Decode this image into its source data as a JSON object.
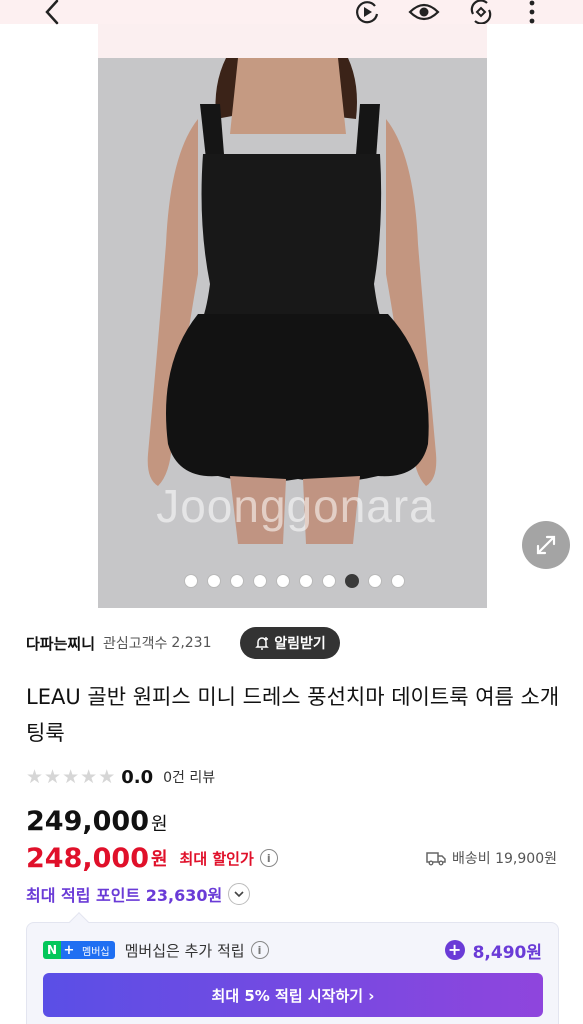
{
  "topbar": {
    "icons": [
      "back-arrow-icon",
      "video-play-icon",
      "eye-icon",
      "rotate-icon",
      "more-vertical-icon"
    ],
    "background": "#fdf0f1"
  },
  "gallery": {
    "watermark": "Joonggonara",
    "total_images": 10,
    "active_index": 8
  },
  "seller": {
    "name": "다파는찌니",
    "follow_label": "관심고객수",
    "follow_count": "2,231",
    "alarm_label": "알림받기"
  },
  "product": {
    "title": "LEAU 골반 원피스 미니 드레스 풍선치마 데이트룩 여름 소개팅룩",
    "rating_score": "0.0",
    "review_label": "0건 리뷰",
    "stars_filled": 0
  },
  "price": {
    "original": "249,000",
    "original_unit": "원",
    "sale": "248,000",
    "sale_unit": "원",
    "sale_label": "최대 할인가",
    "shipping": "배송비 19,900원",
    "points": "최대 적립 포인트 23,630원"
  },
  "membership": {
    "badge_n": "N",
    "badge_plus": "+",
    "badge_label": "멤버십",
    "text": "멤버십은 추가 적립",
    "bonus": "8,490원",
    "cta": "최대 5% 적립 시작하기 ›"
  },
  "colors": {
    "sale_red": "#e0102a",
    "points_purple": "#6a3bd7",
    "naver_green": "#03c75a"
  }
}
